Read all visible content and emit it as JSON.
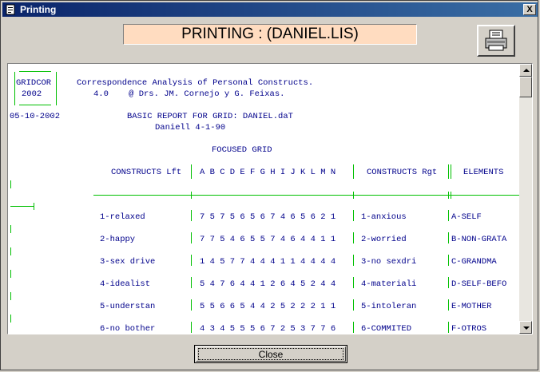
{
  "window": {
    "title": "Printing",
    "close_glyph": "X",
    "icon": "app-printer-icon"
  },
  "banner": {
    "text": "PRINTING  : (DANIEL.LIS)"
  },
  "print_button": {
    "icon": "printer-icon"
  },
  "report": {
    "logo": {
      "line1": "GRIDCOR",
      "line2": "2002"
    },
    "header1": "Correspondence Analysis of Personal Constructs.",
    "header2": "4.0    @ Drs. JM. Cornejo y G. Feixas.",
    "date": "05-10-2002",
    "subtitle": "BASIC REPORT FOR GRID: DANIEL.daT",
    "subtitle2": "Daniell 4-1-90",
    "focused": "FOCUSED GRID",
    "col_left": "CONSTRUCTS Lft",
    "col_letters": "A B C D E F G H I J K L M N",
    "col_right": "CONSTRUCTS Rgt",
    "col_elements": "ELEMENTS",
    "rows": [
      {
        "left": "1-relaxed",
        "ratings": "7 5 7 5 6 5 6 7 4 6 5 6 2 1",
        "right": "1-anxious",
        "element": "A-SELF"
      },
      {
        "left": "2-happy",
        "ratings": "7 7 5 4 6 5 5 7 4 6 4 4 1 1",
        "right": "2-worried",
        "element": "B-NON-GRATA"
      },
      {
        "left": "3-sex drive",
        "ratings": "1 4 5 7 7 4 4 4 1 1 4 4 4 4",
        "right": "3-no sexdri",
        "element": "C-GRANDMA"
      },
      {
        "left": "4-idealist",
        "ratings": "5 4 7 6 4 4 1 2 6 4 5 2 4 4",
        "right": "4-materiali",
        "element": "D-SELF-BEFO"
      },
      {
        "left": "5-understan",
        "ratings": "5 5 6 6 5 4 4 2 5 2 2 2 1 1",
        "right": "5-intoleran",
        "element": "E-MOTHER"
      },
      {
        "left": "6-no bother",
        "ratings": "4 3 4 5 5 5 6 7 2 5 3 7 7 6",
        "right": "6-COMMITED",
        "element": "F-OTROS"
      }
    ]
  },
  "footer": {
    "close_label": "Close"
  }
}
